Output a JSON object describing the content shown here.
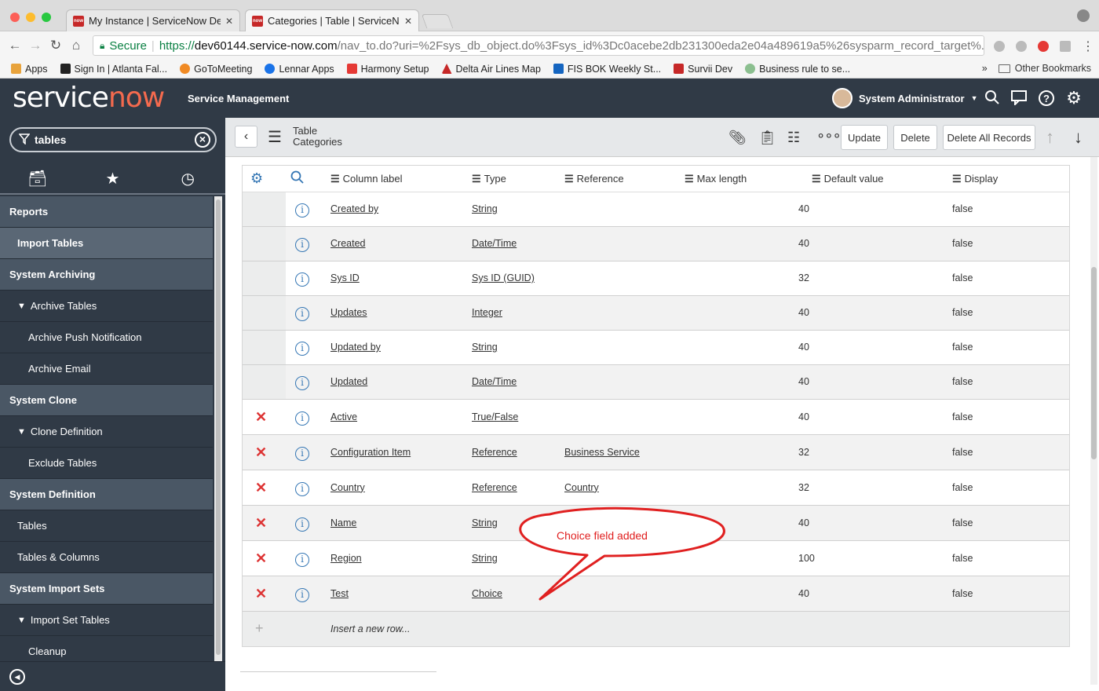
{
  "browser": {
    "tabs": [
      {
        "title": "My Instance | ServiceNow Dev",
        "favicon": "now"
      },
      {
        "title": "Categories | Table | ServiceNo",
        "favicon": "now"
      }
    ],
    "secure_label": "Secure",
    "url_scheme": "https://",
    "url_host": "dev60144.service-now.com",
    "url_rest": "/nav_to.do?uri=%2Fsys_db_object.do%3Fsys_id%3Dc0acebe2db231300eda2e04a489619a5%26sysparm_record_target%...",
    "bookmarks": [
      {
        "label": "Apps",
        "color": "#e8a33c"
      },
      {
        "label": "Sign In | Atlanta Fal...",
        "color": "#222222"
      },
      {
        "label": "GoToMeeting",
        "color": "#f08a24"
      },
      {
        "label": "Lennar Apps",
        "color": "#1a73e8"
      },
      {
        "label": "Harmony Setup",
        "color": "#e53935"
      },
      {
        "label": "Delta Air Lines Map",
        "color": "#c62828"
      },
      {
        "label": "FIS BOK Weekly St...",
        "color": "#1565c0"
      },
      {
        "label": "Survii Dev",
        "color": "#c62828"
      },
      {
        "label": "Business rule to se...",
        "color": "#8bbf8f"
      }
    ],
    "other_bookmarks": "Other Bookmarks"
  },
  "header": {
    "logo_service": "service",
    "logo_now": "now",
    "product": "Service Management",
    "user": "System Administrator"
  },
  "sidebar": {
    "filter_value": "tables",
    "items": [
      {
        "label": "Reports",
        "kind": "sec"
      },
      {
        "label": "Import Tables",
        "kind": "sel"
      },
      {
        "label": "System Archiving",
        "kind": "sec"
      },
      {
        "label": "Archive Tables",
        "kind": "lvl1",
        "expanded": true
      },
      {
        "label": "Archive Push Notification",
        "kind": "lvl2"
      },
      {
        "label": "Archive Email",
        "kind": "lvl2"
      },
      {
        "label": "System Clone",
        "kind": "sec"
      },
      {
        "label": "Clone Definition",
        "kind": "lvl1",
        "expanded": true
      },
      {
        "label": "Exclude Tables",
        "kind": "lvl2"
      },
      {
        "label": "System Definition",
        "kind": "sec"
      },
      {
        "label": "Tables",
        "kind": "lvl1"
      },
      {
        "label": "Tables & Columns",
        "kind": "lvl1"
      },
      {
        "label": "System Import Sets",
        "kind": "sec"
      },
      {
        "label": "Import Set Tables",
        "kind": "lvl1",
        "expanded": true
      },
      {
        "label": "Cleanup",
        "kind": "lvl2"
      }
    ]
  },
  "form": {
    "title_line1": "Table",
    "title_line2": "Categories",
    "buttons": {
      "update": "Update",
      "delete": "Delete",
      "delete_all": "Delete All Records"
    }
  },
  "table": {
    "columns": [
      "Column label",
      "Type",
      "Reference",
      "Max length",
      "Default value",
      "Display"
    ],
    "rows": [
      {
        "label": "Created by",
        "type": "String",
        "reference": "",
        "max_length": "40",
        "default_value": "",
        "display": "false",
        "deletable": false
      },
      {
        "label": "Created",
        "type": "Date/Time",
        "reference": "",
        "max_length": "40",
        "default_value": "",
        "display": "false",
        "deletable": false
      },
      {
        "label": "Sys ID",
        "type": "Sys ID (GUID)",
        "reference": "",
        "max_length": "32",
        "default_value": "",
        "display": "false",
        "deletable": false
      },
      {
        "label": "Updates",
        "type": "Integer",
        "reference": "",
        "max_length": "40",
        "default_value": "",
        "display": "false",
        "deletable": false
      },
      {
        "label": "Updated by",
        "type": "String",
        "reference": "",
        "max_length": "40",
        "default_value": "",
        "display": "false",
        "deletable": false
      },
      {
        "label": "Updated",
        "type": "Date/Time",
        "reference": "",
        "max_length": "40",
        "default_value": "",
        "display": "false",
        "deletable": false
      },
      {
        "label": "Active",
        "type": "True/False",
        "reference": "",
        "max_length": "40",
        "default_value": "",
        "display": "false",
        "deletable": true
      },
      {
        "label": "Configuration Item",
        "type": "Reference",
        "reference": "Business Service",
        "max_length": "32",
        "default_value": "",
        "display": "false",
        "deletable": true
      },
      {
        "label": "Country",
        "type": "Reference",
        "reference": "Country",
        "max_length": "32",
        "default_value": "",
        "display": "false",
        "deletable": true
      },
      {
        "label": "Name",
        "type": "String",
        "reference": "",
        "max_length": "40",
        "default_value": "",
        "display": "false",
        "deletable": true
      },
      {
        "label": "Region",
        "type": "String",
        "reference": "",
        "max_length": "100",
        "default_value": "",
        "display": "false",
        "deletable": true
      },
      {
        "label": "Test",
        "type": "Choice",
        "reference": "",
        "max_length": "40",
        "default_value": "",
        "display": "false",
        "deletable": true
      }
    ],
    "insert_row_label": "Insert a new row..."
  },
  "callout": {
    "text": "Choice field added",
    "color": "#e02020"
  }
}
